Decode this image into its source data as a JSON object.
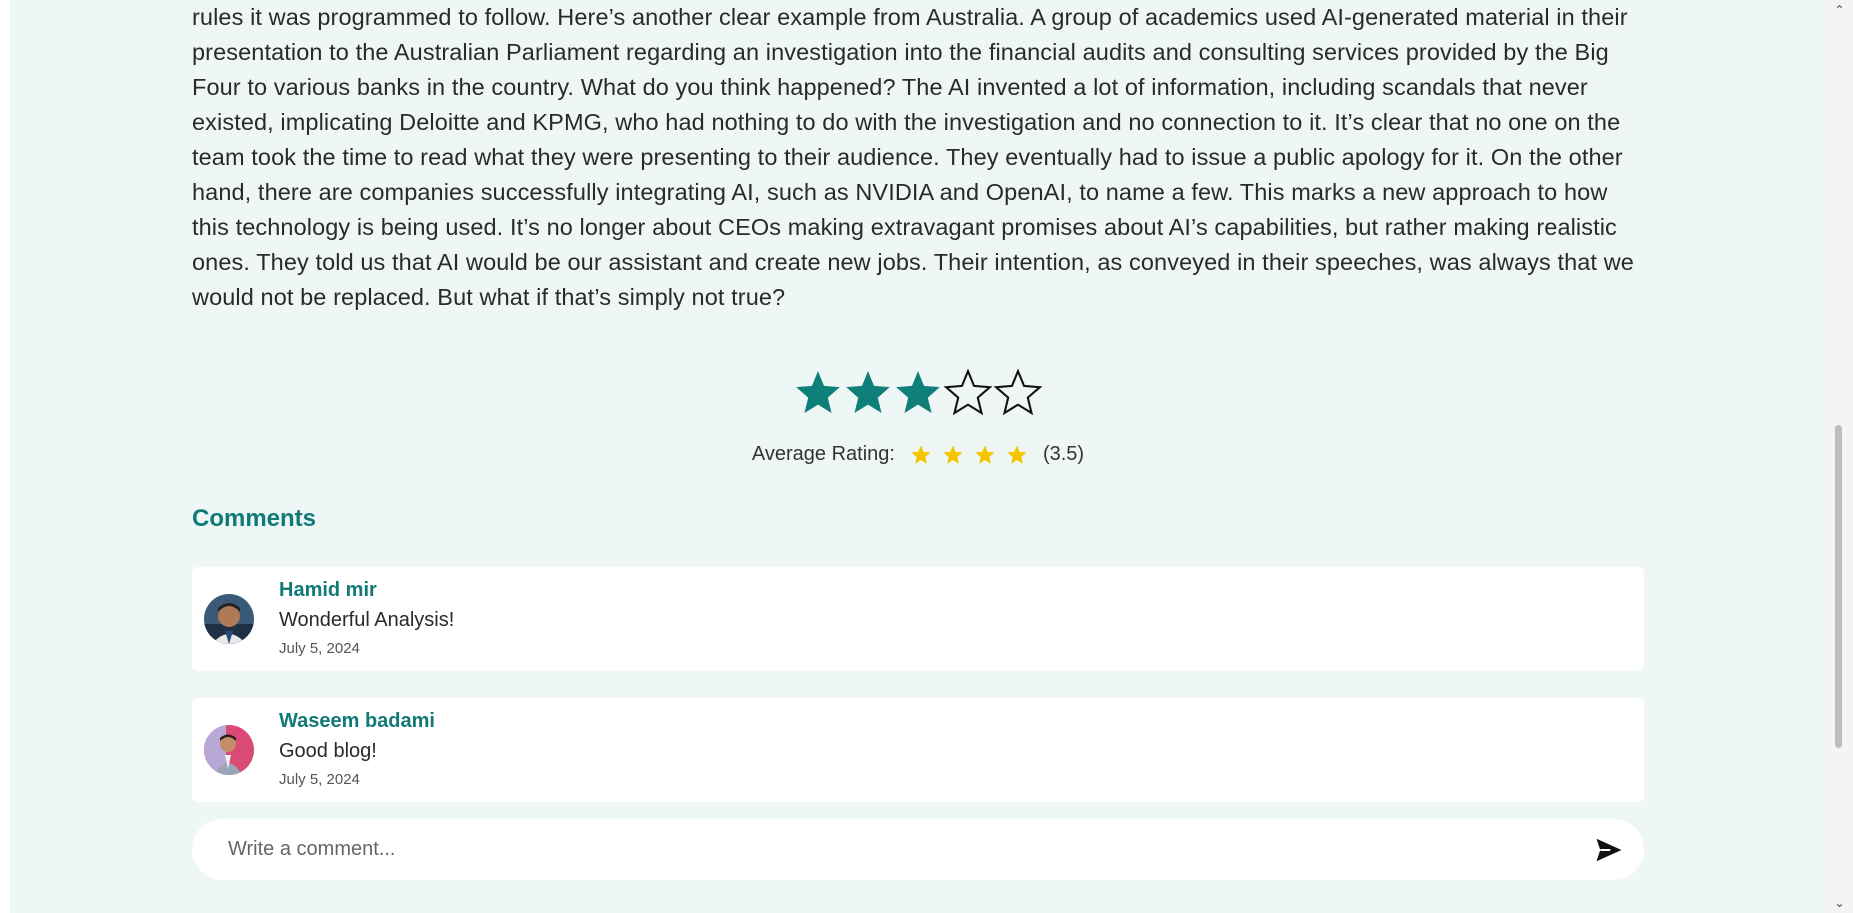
{
  "article": {
    "text": "rules it was programmed to follow. Here’s another clear example from Australia. A group of academics used AI-generated material in their presentation to the Australian Parliament regarding an investigation into the financial audits and consulting services provided by the Big Four to various banks in the country. What do you think happened? The AI invented a lot of information, including scandals that never existed, implicating Deloitte and KPMG, who had nothing to do with the investigation and no connection to it. It’s clear that no one on the team took the time to read what they were presenting to their audience. They eventually had to issue a public apology for it. On the other hand, there are companies successfully integrating AI, such as NVIDIA and OpenAI, to name a few. This marks a new approach to how this technology is being used. It’s no longer about CEOs making extravagant promises about AI’s capabilities, but rather making realistic ones. They told us that AI would be our assistant and create new jobs. Their intention, as conveyed in their speeches, was always that we would not be replaced. But what if that’s simply not true?"
  },
  "rating": {
    "user_stars_filled": 3,
    "user_stars_total": 5,
    "average_label": "Average Rating:",
    "average_stars_shown": 4,
    "average_value": "(3.5)",
    "filled_color": "#0f7f7a",
    "average_star_color": "#f5c400"
  },
  "comments": {
    "heading": "Comments",
    "items": [
      {
        "name": "Hamid mir",
        "text": "Wonderful Analysis!",
        "date": "July 5, 2024"
      },
      {
        "name": "Waseem badami",
        "text": "Good blog!",
        "date": "July 5, 2024"
      }
    ],
    "input_placeholder": "Write a comment..."
  },
  "icons": {
    "send": "send-icon",
    "star": "star-icon",
    "scroll_up": "chevron-up-icon",
    "scroll_down": "chevron-down-icon"
  },
  "scrollbar": {
    "up_glyph": "⌃",
    "down_glyph": "⌄"
  }
}
